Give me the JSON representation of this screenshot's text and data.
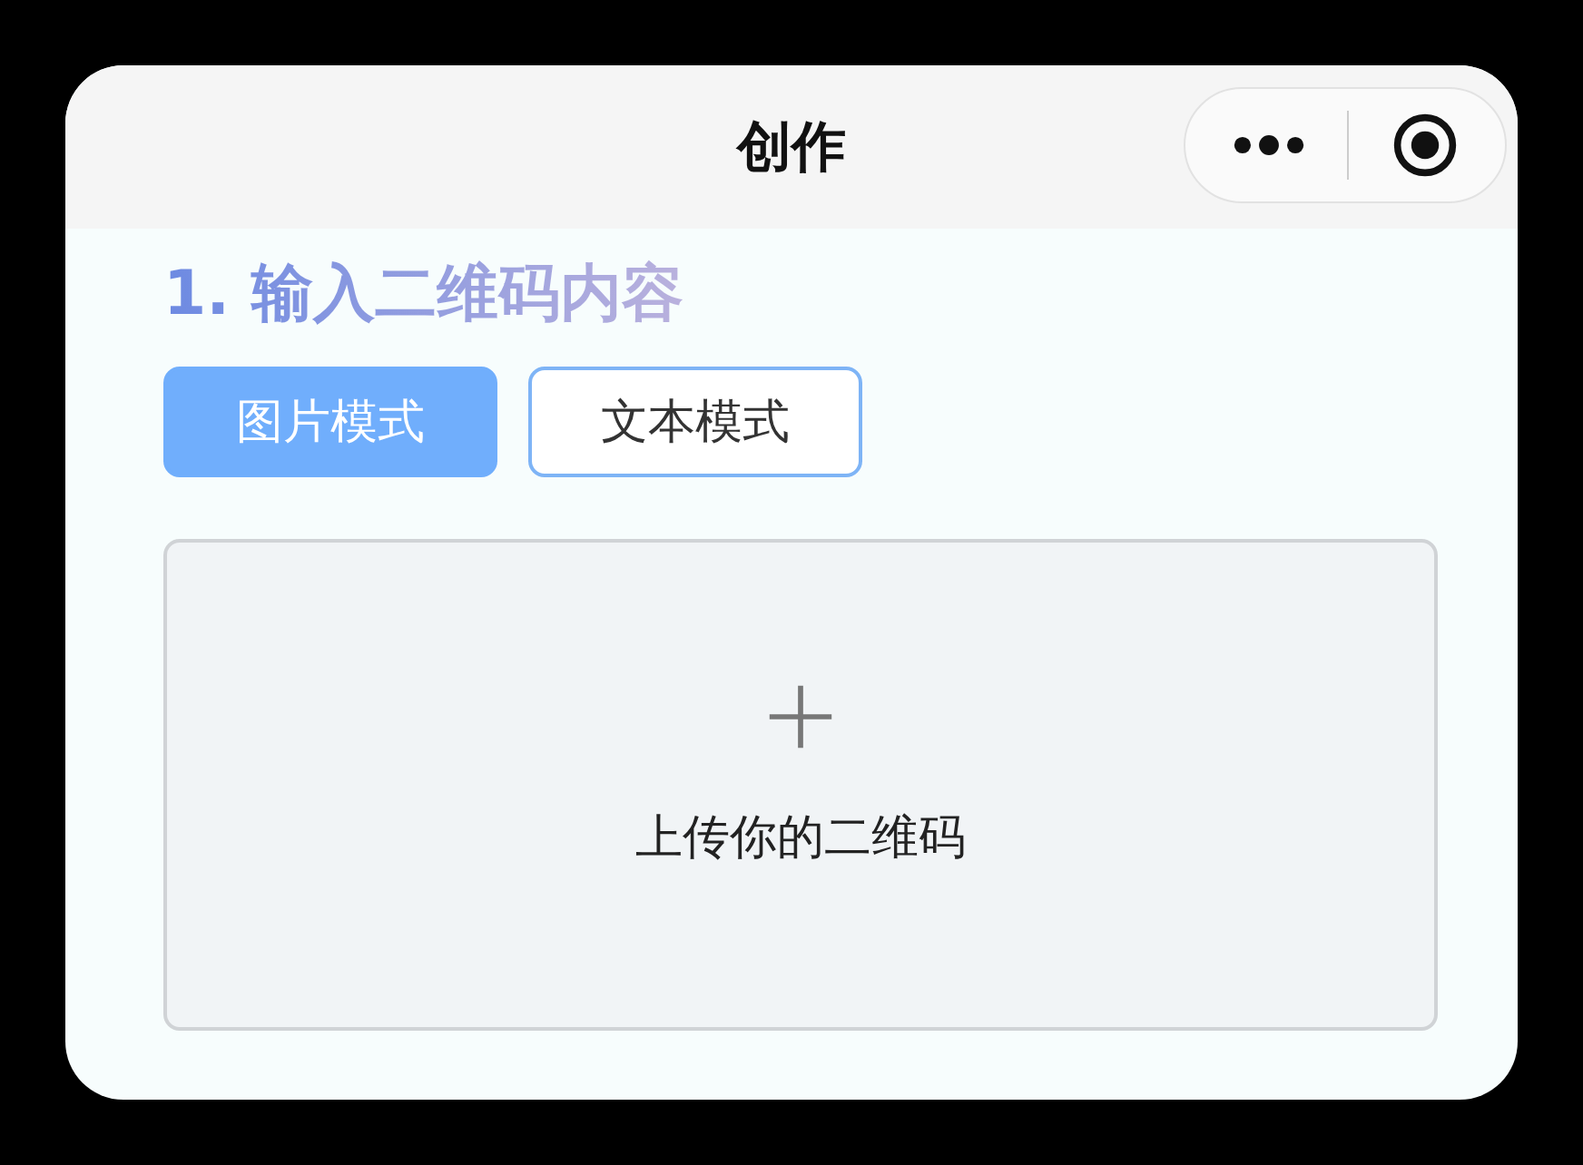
{
  "window": {
    "title": "创作"
  },
  "section": {
    "heading": "1. 输入二维码内容"
  },
  "modes": [
    {
      "label": "图片模式",
      "selected": true
    },
    {
      "label": "文本模式",
      "selected": false
    }
  ],
  "upload": {
    "label": "上传你的二维码"
  }
}
